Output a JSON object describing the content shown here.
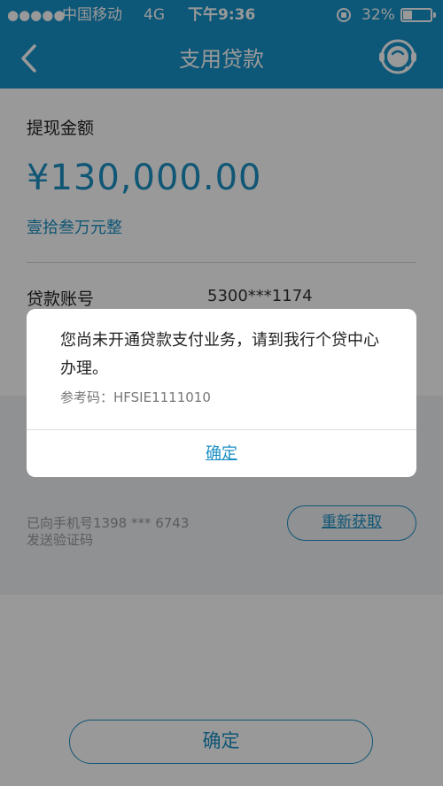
{
  "status_bar": {
    "signal_dots": "●●●●●",
    "carrier": "中国移动",
    "network": "4G",
    "time": "下午9:36",
    "battery_percent": "32%",
    "battery_level": 0.32
  },
  "nav": {
    "title": "支用贷款",
    "back_icon": "chevron-left-icon",
    "service_icon": "customer-service-icon"
  },
  "withdrawal": {
    "label": "提现金额",
    "amount": "¥130,000.00",
    "amount_in_words": "壹拾叁万元整"
  },
  "account": {
    "label": "贷款账号",
    "number": "5300***1174"
  },
  "verification": {
    "hint_line1": "已向手机号1398 *** 6743",
    "hint_line2": "发送验证码",
    "resend_label": "重新获取"
  },
  "footer": {
    "confirm_label": "确定"
  },
  "dialog": {
    "message": "您尚未开通贷款支付业务，请到我行个贷中心办理。",
    "reference": "参考码：HFSIE1111010",
    "ok_label": "确定"
  },
  "colors": {
    "brand": "#1691c8",
    "accent": "#1b8fc4"
  }
}
